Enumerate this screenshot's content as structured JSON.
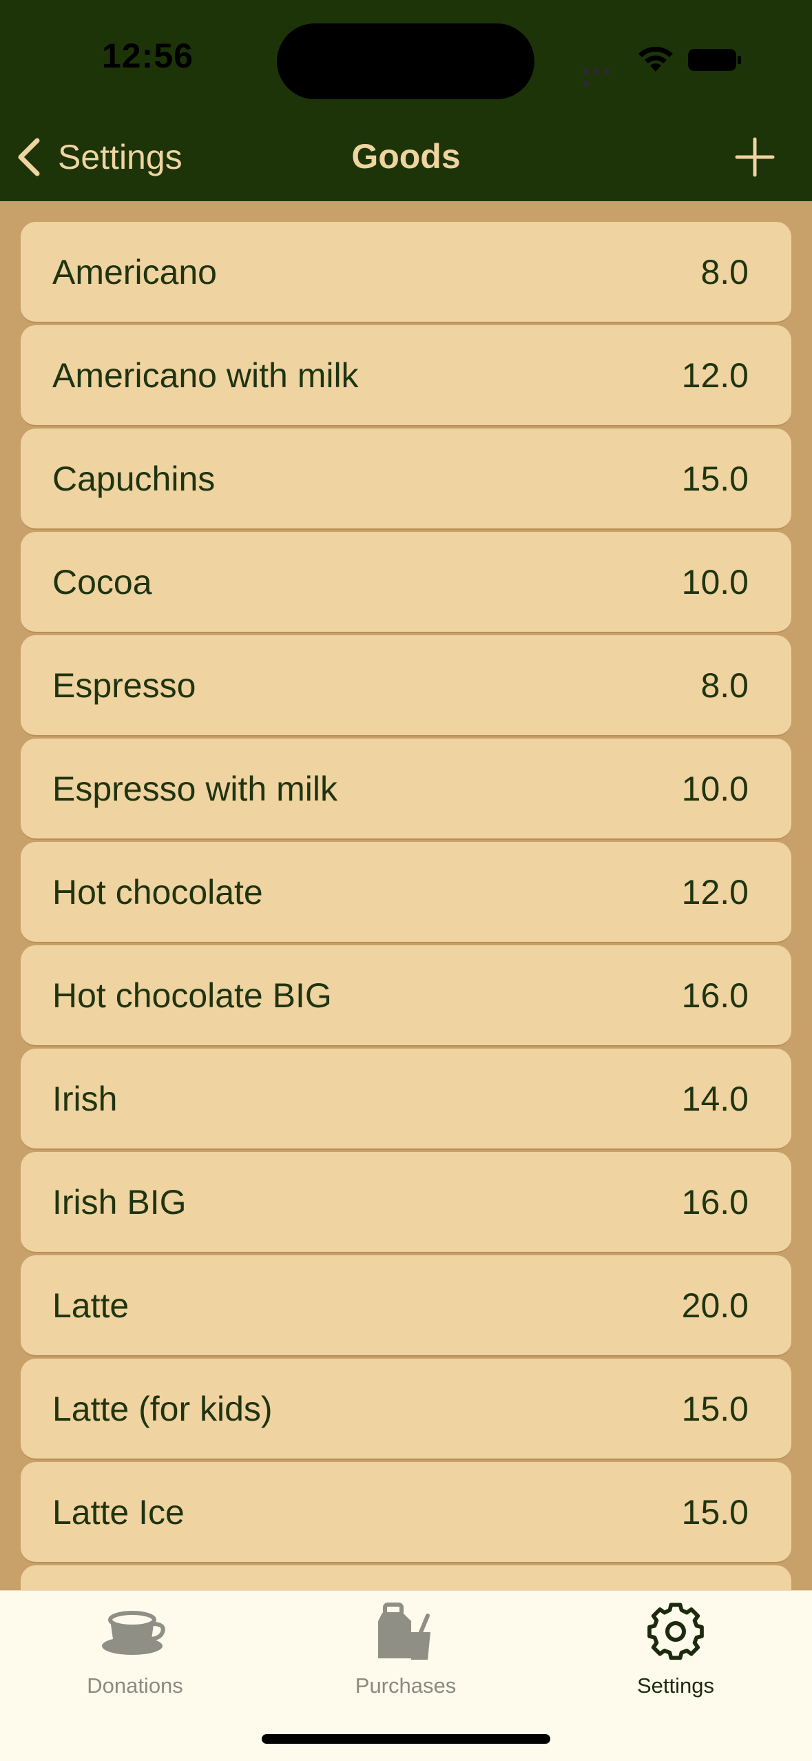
{
  "status_bar": {
    "time": "12:56"
  },
  "nav": {
    "back_label": "Settings",
    "title": "Goods"
  },
  "goods": [
    {
      "name": "Americano",
      "price": "8.0"
    },
    {
      "name": "Americano with milk",
      "price": "12.0"
    },
    {
      "name": "Capuchins",
      "price": "15.0"
    },
    {
      "name": "Cocoa",
      "price": "10.0"
    },
    {
      "name": "Espresso",
      "price": "8.0"
    },
    {
      "name": "Espresso with milk",
      "price": "10.0"
    },
    {
      "name": "Hot chocolate",
      "price": "12.0"
    },
    {
      "name": "Hot chocolate BIG",
      "price": "16.0"
    },
    {
      "name": "Irish",
      "price": "14.0"
    },
    {
      "name": "Irish BIG",
      "price": "16.0"
    },
    {
      "name": "Latte",
      "price": "20.0"
    },
    {
      "name": "Latte (for kids)",
      "price": "15.0"
    },
    {
      "name": "Latte Ice",
      "price": "15.0"
    },
    {
      "name": "",
      "price": ""
    }
  ],
  "tabs": [
    {
      "label": "Donations",
      "icon": "coffee-cup-icon",
      "active": false
    },
    {
      "label": "Purchases",
      "icon": "shopping-bag-icon",
      "active": false
    },
    {
      "label": "Settings",
      "icon": "gear-icon",
      "active": true
    }
  ],
  "colors": {
    "header_bg": "#1d3409",
    "list_bg": "#c7a06a",
    "row_bg": "#efd3a0",
    "text": "#1f3410",
    "nav_text": "#f0d4a0",
    "tabbar_bg": "#fefbec"
  }
}
